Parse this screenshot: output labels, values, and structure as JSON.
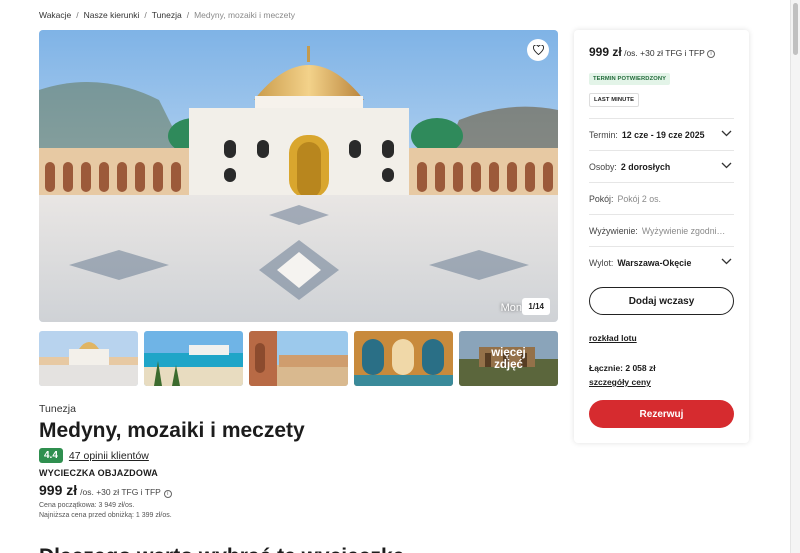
{
  "breadcrumb": [
    "Wakacje",
    "Nasze kierunki",
    "Tunezja",
    "Medyny, mozaiki i meczety"
  ],
  "gallery": {
    "caption": "Mon",
    "counter": "1/14",
    "more_label_1": "więcej",
    "more_label_2": "zdjęć"
  },
  "offer": {
    "country": "Tunezja",
    "title": "Medyny, mozaiki i meczety",
    "rating": "4.4",
    "reviews": "47 opinii klientów",
    "trip_type": "WYCIECZKA OBJAZDOWA",
    "price": "999 zł",
    "price_note": "/os. +30 zł TFG i TFP",
    "start_price": "Cena początkowa: 3 949 zł/os.",
    "lowest_price": "Najniższa cena przed obniżką: 1 399 zł/os.",
    "next_heading": "Dlaczego warto wybrać tę wycieczkę"
  },
  "panel": {
    "price": "999 zł",
    "price_note": "/os. +30 zł TFG i TFP",
    "badge_confirmed": "TERMIN POTWIERDZONY",
    "badge_last_minute": "LAST MINUTE",
    "term_label": "Termin:",
    "term_value": "12 cze - 19 cze 2025",
    "persons_label": "Osoby:",
    "persons_value": "2 dorosłych",
    "room_label": "Pokój:",
    "room_value": "Pokój 2 os.",
    "board_label": "Wyżywienie:",
    "board_value": "Wyżywienie zgodnie z programem",
    "departure_label": "Wylot:",
    "departure_value": "Warszawa-Okęcie",
    "add_button": "Dodaj wczasy",
    "flight_link": "rozkład lotu",
    "total": "Łącznie: 2 058 zł",
    "price_details": "szczegóły ceny",
    "reserve_button": "Rezerwuj"
  },
  "colors": {
    "accent_red": "#d62b2f",
    "rating_green": "#2f8f4f",
    "badge_green_bg": "#e3f4e8"
  },
  "icons": [
    "heart-icon",
    "chevron-down-icon",
    "info-icon"
  ]
}
